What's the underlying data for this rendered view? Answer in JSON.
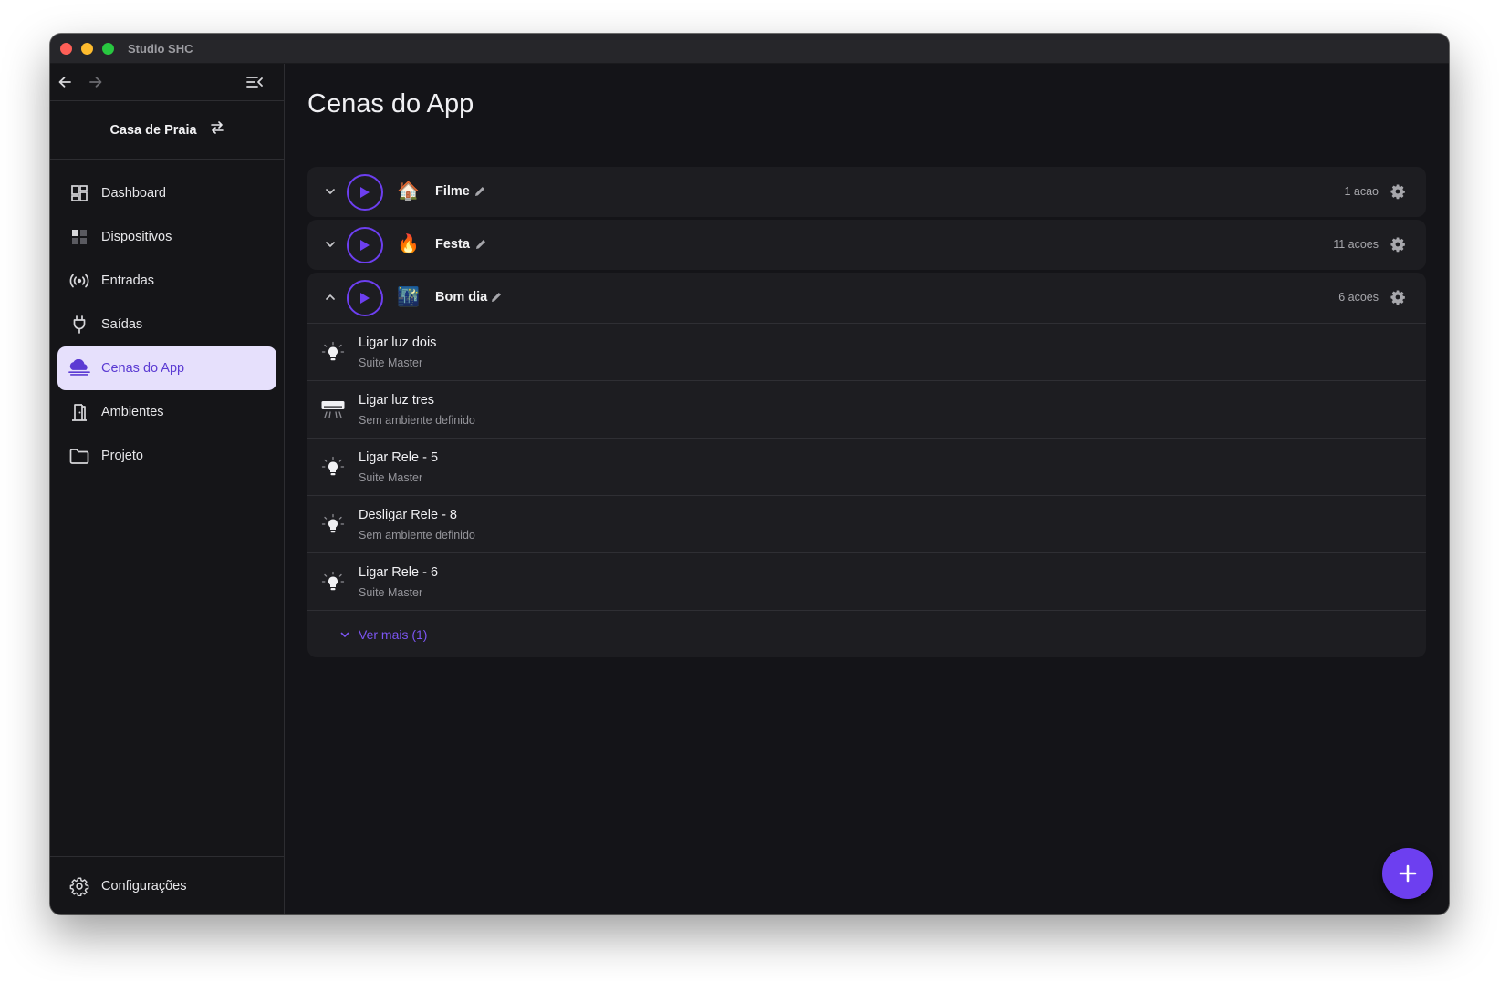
{
  "window": {
    "title": "Studio SHC"
  },
  "sidebar": {
    "workspace": "Casa de Praia",
    "items": [
      {
        "label": "Dashboard",
        "icon": "dashboard-icon"
      },
      {
        "label": "Dispositivos",
        "icon": "devices-icon"
      },
      {
        "label": "Entradas",
        "icon": "broadcast-icon"
      },
      {
        "label": "Saídas",
        "icon": "plug-icon"
      },
      {
        "label": "Cenas do App",
        "icon": "cloud-scene-icon",
        "active": true
      },
      {
        "label": "Ambientes",
        "icon": "door-icon"
      },
      {
        "label": "Projeto",
        "icon": "folder-icon"
      }
    ],
    "settings_label": "Configurações"
  },
  "main": {
    "title": "Cenas do App",
    "scenes": [
      {
        "name": "Filme",
        "emoji": "🏠",
        "count": "1 acao",
        "expanded": false
      },
      {
        "name": "Festa",
        "emoji": "🔥",
        "count": "11 acoes",
        "expanded": false
      },
      {
        "name": "Bom dia",
        "emoji": "🌃",
        "count": "6 acoes",
        "expanded": true,
        "actions": [
          {
            "title": "Ligar luz dois",
            "subtitle": "Suite Master",
            "icon": "lightbulb-icon"
          },
          {
            "title": "Ligar luz tres",
            "subtitle": "Sem ambiente definido",
            "icon": "air-conditioner-icon"
          },
          {
            "title": "Ligar Rele - 5",
            "subtitle": "Suite Master",
            "icon": "lightbulb-icon"
          },
          {
            "title": "Desligar Rele - 8",
            "subtitle": "Sem ambiente definido",
            "icon": "lightbulb-icon"
          },
          {
            "title": "Ligar Rele - 6",
            "subtitle": "Suite Master",
            "icon": "lightbulb-icon"
          }
        ],
        "more_label": "Ver mais (1)"
      }
    ]
  },
  "colors": {
    "accent": "#6d3ff0",
    "active_bg": "#e6e0fc",
    "window_bg": "#141418",
    "card_bg": "#1d1d21"
  }
}
